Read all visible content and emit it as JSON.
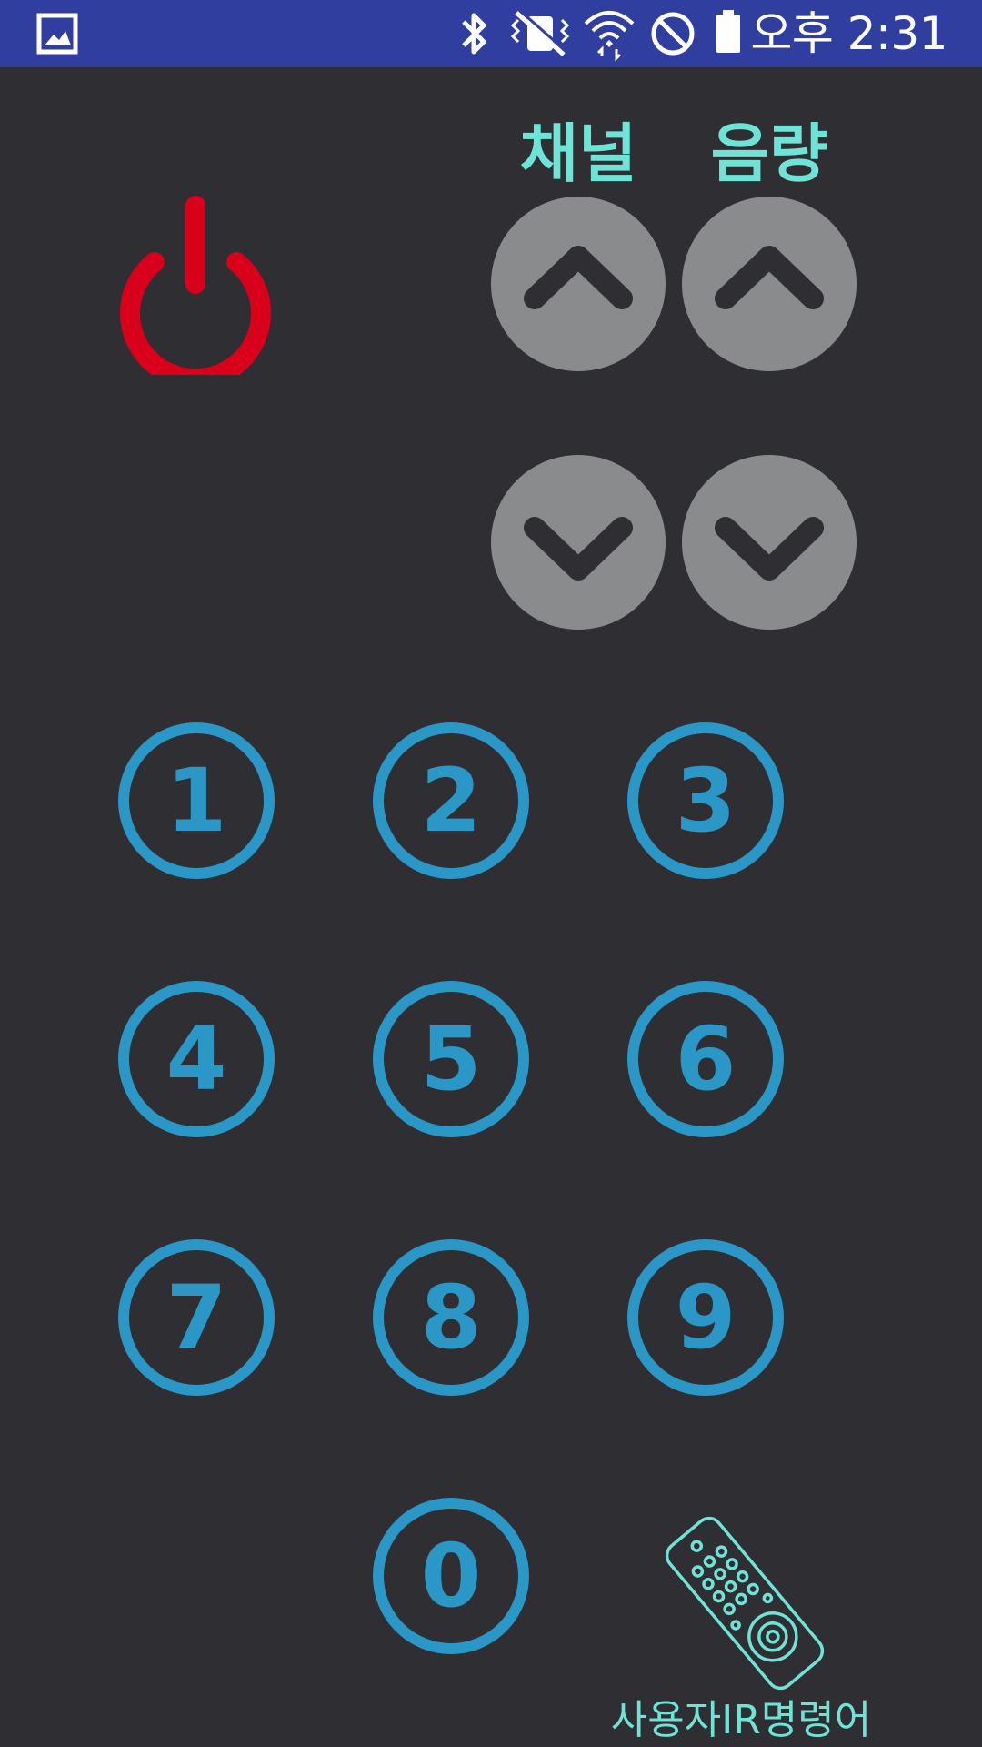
{
  "status_bar": {
    "time": "오후 2:31",
    "icons": [
      "gallery-icon",
      "bluetooth-icon",
      "vibrate-mode-icon",
      "wifi-icon",
      "do-not-disturb-icon",
      "battery-icon"
    ],
    "background_color": "#303f9f"
  },
  "remote": {
    "channel_label": "채널",
    "volume_label": "음량",
    "power_color": "#d9001b",
    "label_color": "#6fe3d5",
    "number_color": "#2b97c6",
    "round_button_color": "#8a8b8d",
    "numbers": [
      "1",
      "2",
      "3",
      "4",
      "5",
      "6",
      "7",
      "8",
      "9",
      "0"
    ],
    "custom_ir_label": "사용자IR명령어"
  }
}
